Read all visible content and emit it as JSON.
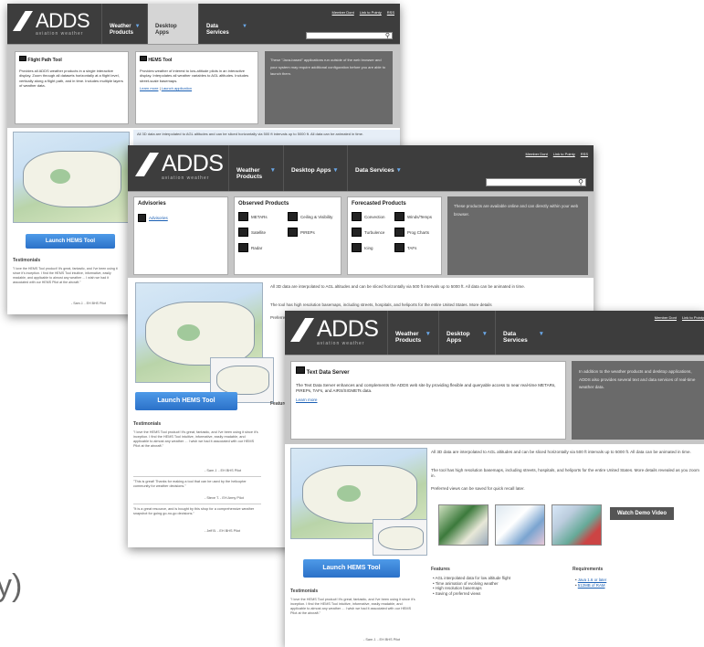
{
  "brand": {
    "name": "ADDS",
    "tagline": "aviation weather"
  },
  "nav": {
    "weather_products": "Weather Products",
    "desktop_apps": "Desktop Apps",
    "data_services": "Data Services"
  },
  "top_links": {
    "member_dont": "Member Dont",
    "link_pointy": "Link to Pointy",
    "rss": "RSS"
  },
  "screen1": {
    "panel1_title": "Flight Path Tool",
    "panel1_body": "Provides all ADDS weather products in a single interactive display. Zoom through all datasets horizontally at a flight level, vertically along a flight path, and in time. Includes multiple layers of weather data.",
    "panel2_title": "HEMS Tool",
    "panel2_body": "Provides weather of interest to low-altitude pilots in an interactive display. Interpolates all weather variables to AGL altitudes. Includes street-scale basemaps.",
    "links": [
      "Learn more",
      "Launch application"
    ],
    "gray_text": "These \"Java-based\" applications run outside of the web browser and your system may require additional configuration before you are able to launch them.",
    "info_bar": "All 3D data are interpolated to AGL altitudes and can be sliced horizontally via 500 ft intervals up to 5000 ft. All data can be animated in time.",
    "button": "Launch HEMS Tool",
    "testimonials": "Testimonials",
    "quote": "\"I love the HEMS Tool product! It's great, fantastic, and I've been using it since it's inception. I find the HEMS Tool intuitive, informative, easily readable, and applicable to almost any weather ... I wish we had it associated with our HEMS Pilot at the aircraft.\"",
    "attribution": "- Sam J. - EH BHS Pilot"
  },
  "screen2": {
    "advisories_title": "Advisories",
    "advisories_item": "Advisories",
    "observed_title": "Observed Products",
    "observed": [
      "METARs",
      "Ceiling & Visibility",
      "Satellite",
      "PIREPs",
      "Radar"
    ],
    "forecast_title": "Forecasted Products",
    "forecast": [
      "Convection",
      "Winds/Temps",
      "Turbulence",
      "Prog Charts",
      "Icing",
      "TAFs"
    ],
    "gray_text": "These products are available online and can directly within your web browser.",
    "info1": "All 3D data are interpolated to AGL altitudes and can be sliced horizontally via 500 ft intervals up to 5000 ft. All data can be animated in time.",
    "info2": "The tool has high resolution basemaps, including streets, hospitals, and heliports for the entire United States. More details",
    "preferred": "Preferred",
    "features": "Features",
    "button": "Launch HEMS Tool",
    "testimonials": "Testimonials",
    "quote1": "\"I love the HEMS Tool product! It's great, fantastic, and I've been using it since it's inception. I find the HEMS Tool intuitive, informative, easily readable, and applicable to almost any weather ... I wish we had it associated with our HEMS Pilot at the aircraft.\"",
    "attr1": "- Sam J. - EH BHS Pilot",
    "quote2": "\"This is great! Thanks for making a tool that can be used by the helicopter community for weather decisions.\"",
    "attr2": "- Steve T. - EH Army Pilot",
    "quote3": "\"It is a great resource, and is bought by this shop for a comprehensive weather snapshot for going go-no-go decisions.\"",
    "attr3": "- Jeff B. - EH BHS Pilot"
  },
  "screen3": {
    "panel_title": "Text Data Server",
    "panel_body": "The Text Data Server enhances and complements the ADDS web site by providing flexible and queryable access to near real-time METARs, PIREPs, TAFs, and AIRS/SIGMETs data.",
    "panel_link": "Learn more",
    "gray_text": "In addition to the weather products and desktop applications, ADDS also provides several text and data services of real-time weather data.",
    "info1": "All 3D data are interpolated to AGL altitudes and can be sliced horizontally via 500 ft intervals up to 5000 ft. All data can be animated in time.",
    "info2": "The tool has high resolution basemaps, including streets, hospitals, and heliports for the entire United States. More details revealed as you zoom in.",
    "info3": "Preferred views can be saved for quick recall later.",
    "demo": "Watch Demo Video",
    "button": "Launch HEMS Tool",
    "features_title": "Features",
    "features": [
      "AGL interpolated data for low altitude flight",
      "Time animation of evolving weather",
      "High resolution basemaps",
      "Saving of preferred views"
    ],
    "req_title": "Requirements",
    "requirements": [
      "Java 1.6 or later",
      "512MB of RAM"
    ],
    "testimonials": "Testimonials",
    "quote": "\"I love the HEMS Tool product! It's great, fantastic, and I've been using it since it's inception. I find the HEMS Tool intuitive, informative, easily readable, and applicable to almost any weather ... I wish we had it associated with our HEMS Pilot at the aircraft.\"",
    "attribution": "- Sam J. - EH BHS Pilot"
  },
  "background_text": "y)",
  "colors": {
    "header": "#3d3d3d",
    "menu": "#c6c6c6",
    "gray_panel": "#6a6a6a",
    "button_blue": "#2b71c8",
    "link": "#1a5fb4"
  }
}
